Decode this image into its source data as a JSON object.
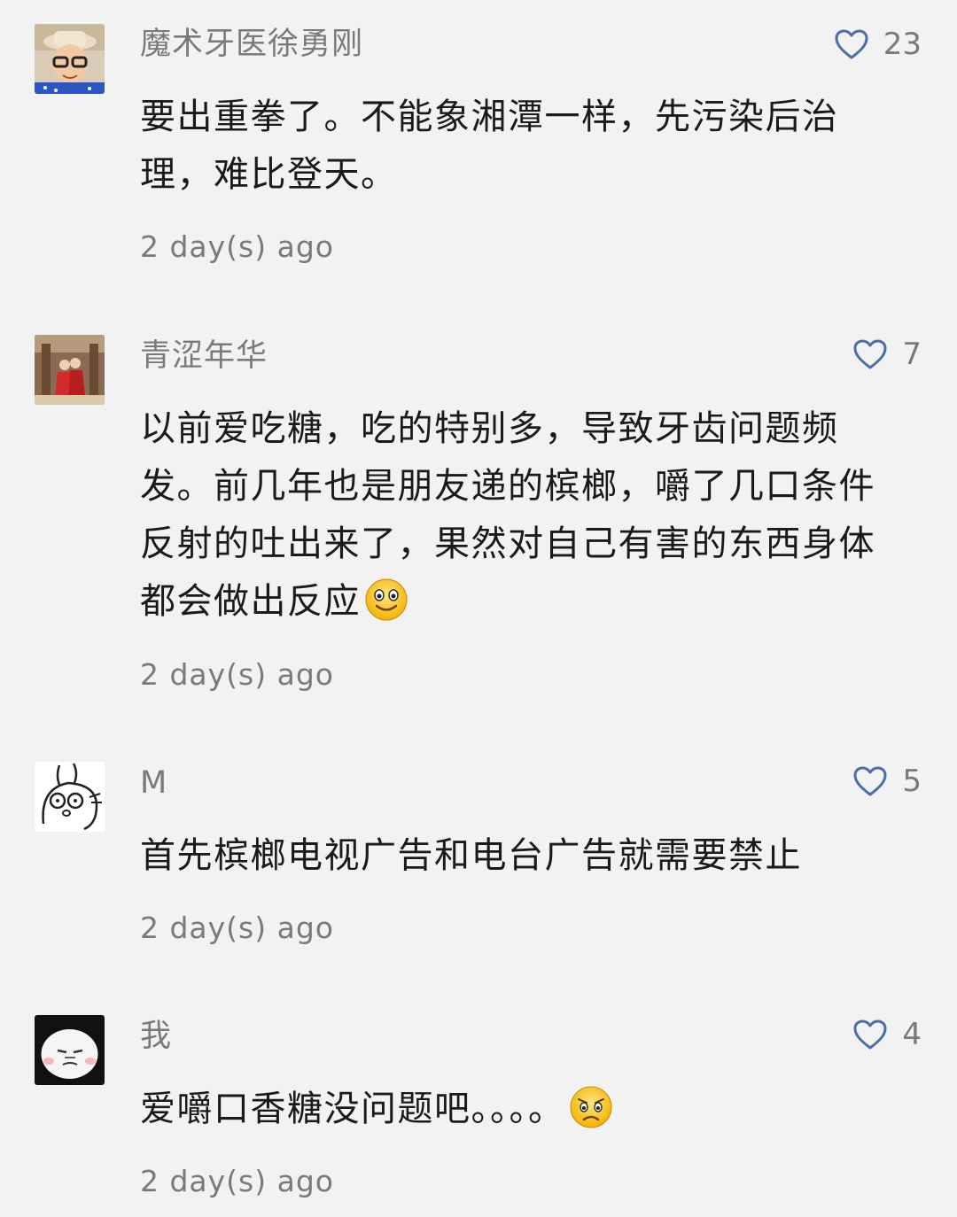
{
  "comments": [
    {
      "username": "魔术牙医徐勇刚",
      "likes": "23",
      "text": "要出重拳了。不能象湘潭一样，先污染后治理，难比登天。",
      "time": "2 day(s) ago",
      "avatar_icon": "avatar-boy-with-glasses-icon"
    },
    {
      "username": "青涩年华",
      "likes": "7",
      "text": "以前爱吃糖，吃的特别多，导致牙齿问题频发。前几年也是朋友递的槟榔，嚼了几口条件反射的吐出来了，果然对自己有害的东西身体都会做出反应",
      "time": "2 day(s) ago",
      "emoji": "smile-emoji",
      "avatar_icon": "avatar-wedding-photo-icon"
    },
    {
      "username": "M",
      "likes": "5",
      "text": "首先槟榔电视广告和电台广告就需要禁止",
      "time": "2 day(s) ago",
      "avatar_icon": "avatar-rabbit-sticker-icon"
    },
    {
      "username": "我",
      "likes": "4",
      "text": "爱嚼口香糖没问题吧。。。。",
      "time": "2 day(s) ago",
      "emoji": "sad-emoji",
      "avatar_icon": "avatar-panda-meme-icon"
    }
  ],
  "colors": {
    "background": "#f2f2f2",
    "meta_text": "#7a7a7a",
    "body_text": "#1a1a1a",
    "heart_stroke": "#4a6ea9"
  }
}
